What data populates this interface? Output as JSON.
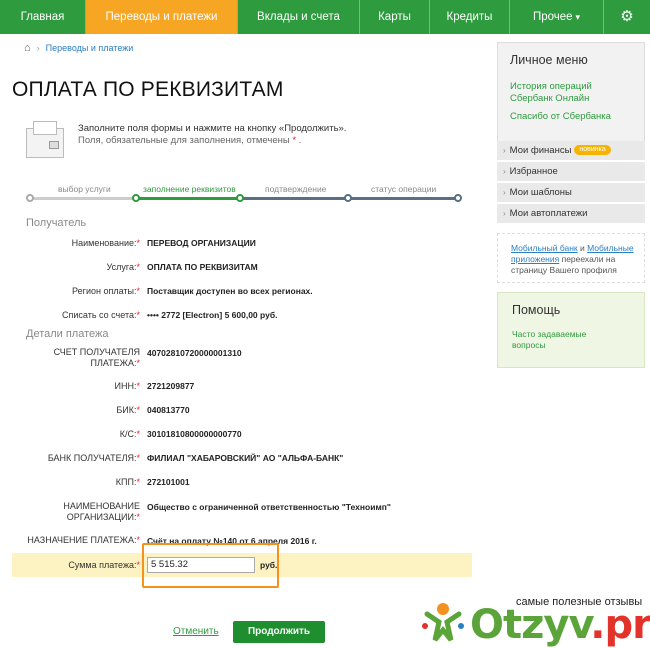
{
  "nav": {
    "items": [
      "Главная",
      "Переводы и платежи",
      "Вклады и счета",
      "Карты",
      "Кредиты",
      "Прочее"
    ],
    "active_index": 1,
    "settings_icon": "gear-icon",
    "colors": {
      "bar": "#2e9b3f",
      "active": "#f6a623"
    }
  },
  "breadcrumb": {
    "home_icon": "home-icon",
    "items": [
      "Переводы и платежи"
    ]
  },
  "page_title": "ОПЛАТА ПО РЕКВИЗИТАМ",
  "intro": {
    "line1": "Заполните поля формы и нажмите на кнопку «Продолжить».",
    "line2": "Поля, обязательные для заполнения, отмечены",
    "req_mark": "*",
    "line2_end": "."
  },
  "steps": {
    "labels": [
      "выбор услуги",
      "заполнение реквизитов",
      "подтверждение",
      "статус операции"
    ],
    "current_index": 1
  },
  "recipient": {
    "title": "Получатель",
    "rows": [
      {
        "label": "Наименование:",
        "value": "ПЕРЕВОД ОРГАНИЗАЦИИ"
      },
      {
        "label": "Услуга:",
        "value": "ОПЛАТА ПО РЕКВИЗИТАМ"
      },
      {
        "label": "Регион оплаты:",
        "value": "Поставщик доступен во всех регионах."
      },
      {
        "label": "Списать со счета:",
        "value": "•••• 2772  [Electron] 5 600,00    руб."
      }
    ]
  },
  "payment": {
    "title": "Детали платежа",
    "rows": [
      {
        "label_1": "СЧЕТ ПОЛУЧАТЕЛЯ",
        "label_2": "ПЛАТЕЖА:",
        "value": "40702810720000001310"
      },
      {
        "label_1": "",
        "label_2": "ИНН:",
        "value": "2721209877"
      },
      {
        "label_1": "",
        "label_2": "БИК:",
        "value": "040813770"
      },
      {
        "label_1": "",
        "label_2": "К/С:",
        "value": "30101810800000000770"
      },
      {
        "label_1": "",
        "label_2": "БАНК ПОЛУЧАТЕЛЯ:",
        "value": "ФИЛИАЛ \"ХАБАРОВСКИЙ\" АО \"АЛЬФА-БАНК\""
      },
      {
        "label_1": "",
        "label_2": "КПП:",
        "value": "272101001"
      },
      {
        "label_1": "НАИМЕНОВАНИЕ",
        "label_2": "ОРГАНИЗАЦИИ:",
        "value": "Общество с ограниченной ответственностью \"Техноимп\""
      },
      {
        "label_1": "",
        "label_2": "НАЗНАЧЕНИЕ ПЛАТЕЖА:",
        "value": "Счёт на оплату №140 от 6 апреля 2016 г."
      }
    ],
    "amount_label": "Сумма платежа:",
    "amount_value": "5 515.32",
    "amount_unit": "руб."
  },
  "actions": {
    "cancel": "Отменить",
    "continue": "Продолжить"
  },
  "sidebar": {
    "menu_title": "Личное меню",
    "links": [
      "История операций Сбербанк Онлайн",
      "Спасибо от Сбербанка"
    ],
    "items": [
      "Мои финансы",
      "Избранное",
      "Мои шаблоны",
      "Мои автоплатежи"
    ],
    "badge": "новинка",
    "tip": {
      "a1": "Мобильный банк",
      "t1": " и ",
      "a2": "Мобильные приложения",
      "t2": " переехали на страницу Вашего профиля"
    },
    "help_title": "Помощь",
    "help_link": "Часто задаваемые вопросы"
  },
  "watermark": {
    "tagline": "самые полезные отзывы",
    "logo_main": "Otzyv",
    "logo_suffix": ".pro"
  }
}
